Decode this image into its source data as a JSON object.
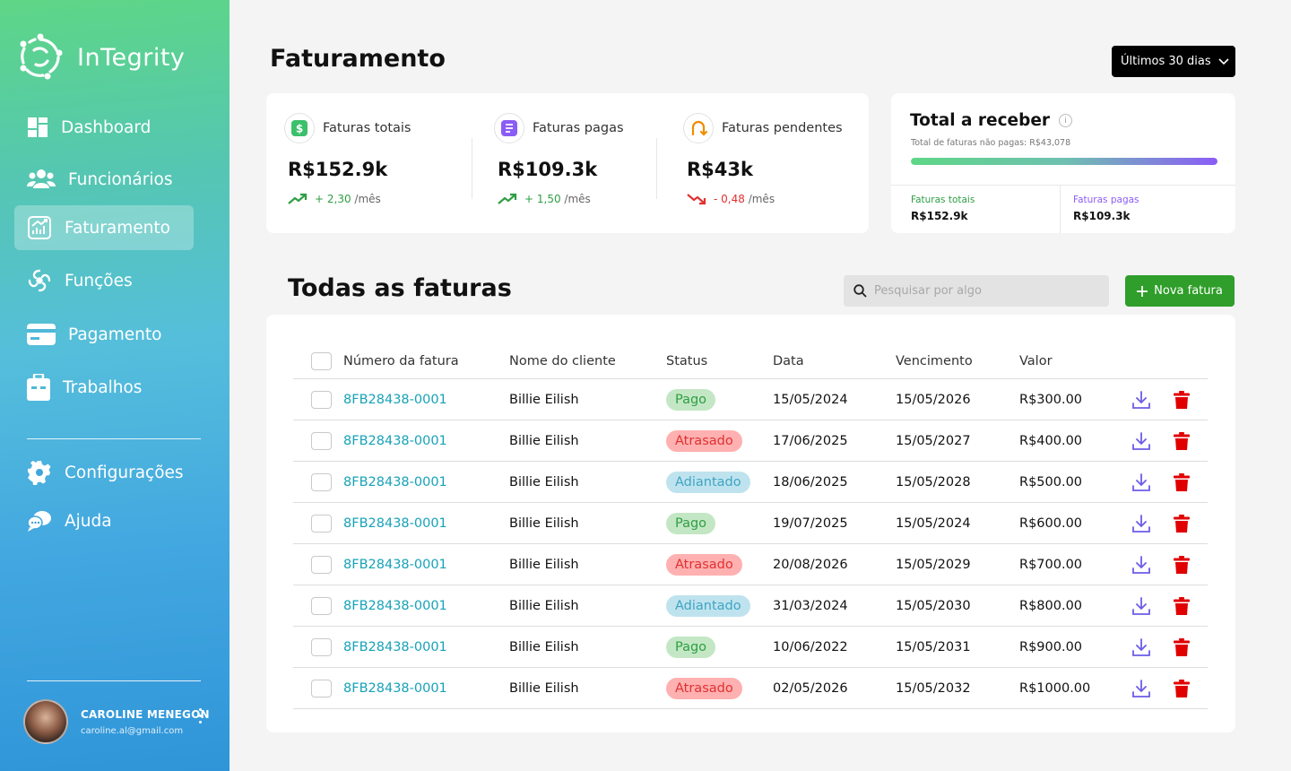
{
  "app": {
    "name": "InTegrity"
  },
  "sidebar": {
    "items": [
      {
        "label": "Dashboard",
        "icon": "dashboard-icon"
      },
      {
        "label": "Funcionários",
        "icon": "users-icon"
      },
      {
        "label": "Faturamento",
        "icon": "billing-chart-icon",
        "active": true
      },
      {
        "label": "Funções",
        "icon": "functions-icon"
      },
      {
        "label": "Pagamento",
        "icon": "credit-card-icon"
      },
      {
        "label": "Trabalhos",
        "icon": "briefcase-icon"
      }
    ],
    "bottom_items": [
      {
        "label": "Configurações",
        "icon": "gear-icon"
      },
      {
        "label": "Ajuda",
        "icon": "help-chat-icon"
      }
    ],
    "user": {
      "name": "CAROLINE MENEGON",
      "email": "caroline.al@gmail.com"
    }
  },
  "header": {
    "title": "Faturamento",
    "range": "Últimos 30 dias"
  },
  "stats": [
    {
      "label": "Faturas totais",
      "value": "R$152.9k",
      "trend": "+ 2,30",
      "unit": "/mês",
      "direction": "up",
      "icon": "dollar-icon"
    },
    {
      "label": "Faturas pagas",
      "value": "R$109.3k",
      "trend": "+ 1,50",
      "unit": "/mês",
      "direction": "up",
      "icon": "receipt-icon"
    },
    {
      "label": "Faturas pendentes",
      "value": "R$43k",
      "trend": "- 0,48",
      "unit": "/mês",
      "direction": "down",
      "icon": "pending-icon"
    }
  ],
  "receivable": {
    "title": "Total a receber",
    "subtitle": "Total de faturas não pagas: R$43,078",
    "progress_fraction": 1.0,
    "paid_label": "Faturas totais",
    "paid_value": "R$152.9k",
    "second_label": "Faturas pagas",
    "second_value": "R$109.3k",
    "colors": {
      "first_label": "#2f9e44",
      "second_label": "#8b5cf6"
    }
  },
  "invoices": {
    "title": "Todas as faturas",
    "search_placeholder": "Pesquisar por algo",
    "new_button": "Nova fatura",
    "columns": [
      "Número da fatura",
      "Nome do cliente",
      "Status",
      "Data",
      "Vencimento",
      "Valor"
    ],
    "rows": [
      {
        "number": "8FB28438-0001",
        "client": "Billie Eilish",
        "status": "Pago",
        "date": "15/05/2024",
        "due": "15/05/2026",
        "value": "R$300.00"
      },
      {
        "number": "8FB28438-0001",
        "client": "Billie Eilish",
        "status": "Atrasado",
        "date": "17/06/2025",
        "due": "15/05/2027",
        "value": "R$400.00"
      },
      {
        "number": "8FB28438-0001",
        "client": "Billie Eilish",
        "status": "Adiantado",
        "date": "18/06/2025",
        "due": "15/05/2028",
        "value": "R$500.00"
      },
      {
        "number": "8FB28438-0001",
        "client": "Billie Eilish",
        "status": "Pago",
        "date": "19/07/2025",
        "due": "15/05/2024",
        "value": "R$600.00"
      },
      {
        "number": "8FB28438-0001",
        "client": "Billie Eilish",
        "status": "Atrasado",
        "date": "20/08/2026",
        "due": "15/05/2029",
        "value": "R$700.00"
      },
      {
        "number": "8FB28438-0001",
        "client": "Billie Eilish",
        "status": "Adiantado",
        "date": "31/03/2024",
        "due": "15/05/2030",
        "value": "R$800.00"
      },
      {
        "number": "8FB28438-0001",
        "client": "Billie Eilish",
        "status": "Pago",
        "date": "10/06/2022",
        "due": "15/05/2031",
        "value": "R$900.00"
      },
      {
        "number": "8FB28438-0001",
        "client": "Billie Eilish",
        "status": "Atrasado",
        "date": "02/05/2026",
        "due": "15/05/2032",
        "value": "R$1000.00"
      }
    ]
  },
  "colors": {
    "accent_green": "#2f9e2a",
    "link": "#16a2b8",
    "download": "#6c5ce7",
    "delete": "#e00000"
  }
}
